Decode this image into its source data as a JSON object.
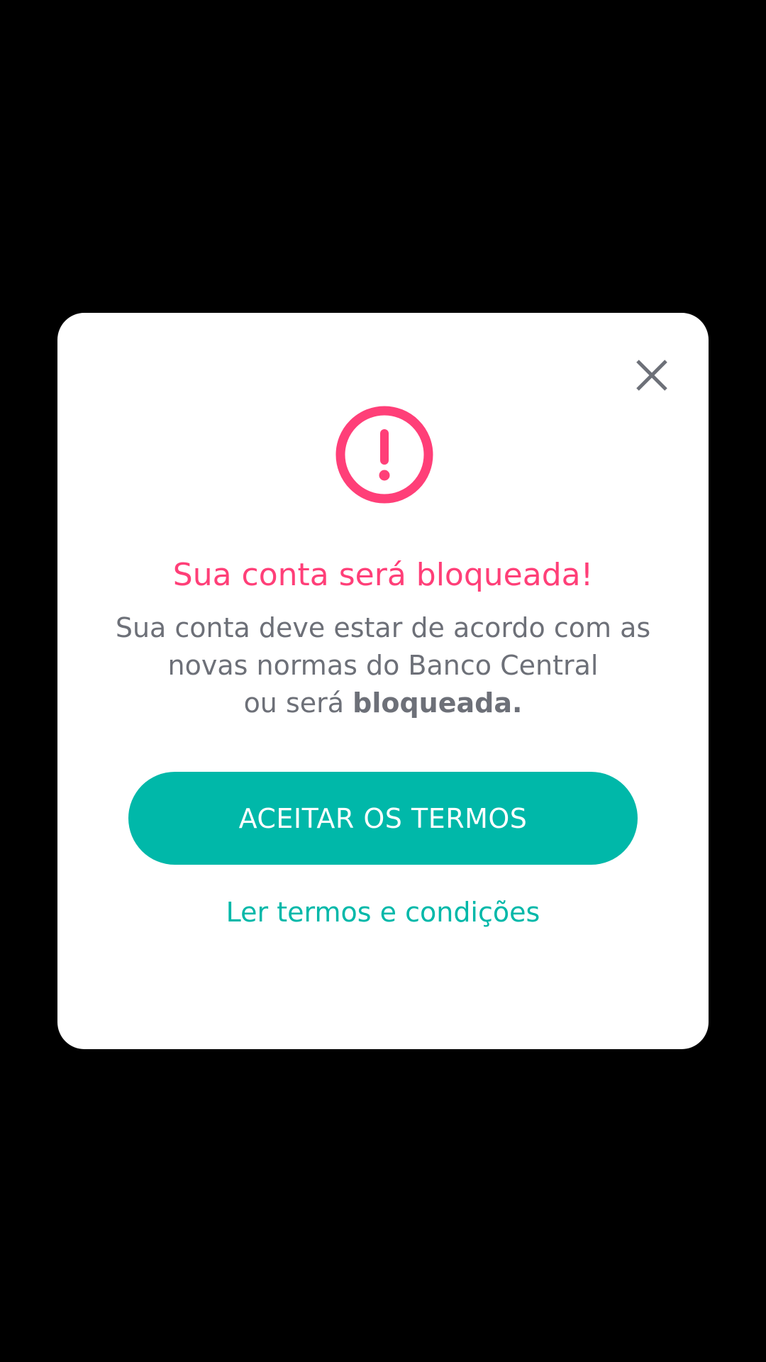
{
  "colors": {
    "backdrop": "#000000",
    "modal_background": "#ffffff",
    "alert": "#ff3f78",
    "accent": "#00b8a9",
    "body_text": "#6d7078",
    "close_icon": "#6d7078"
  },
  "icons": {
    "close": "close-icon",
    "alert": "exclamation-circle-icon"
  },
  "modal": {
    "title": "Sua conta será bloqueada!",
    "message": {
      "line1": "Sua conta deve estar de acordo com as",
      "line2": "novas normas do Banco Central",
      "line3_prefix": "ou será ",
      "line3_bold": "bloqueada."
    },
    "primary_button_label": "ACEITAR OS TERMOS",
    "terms_link_label": "Ler termos e condições"
  }
}
